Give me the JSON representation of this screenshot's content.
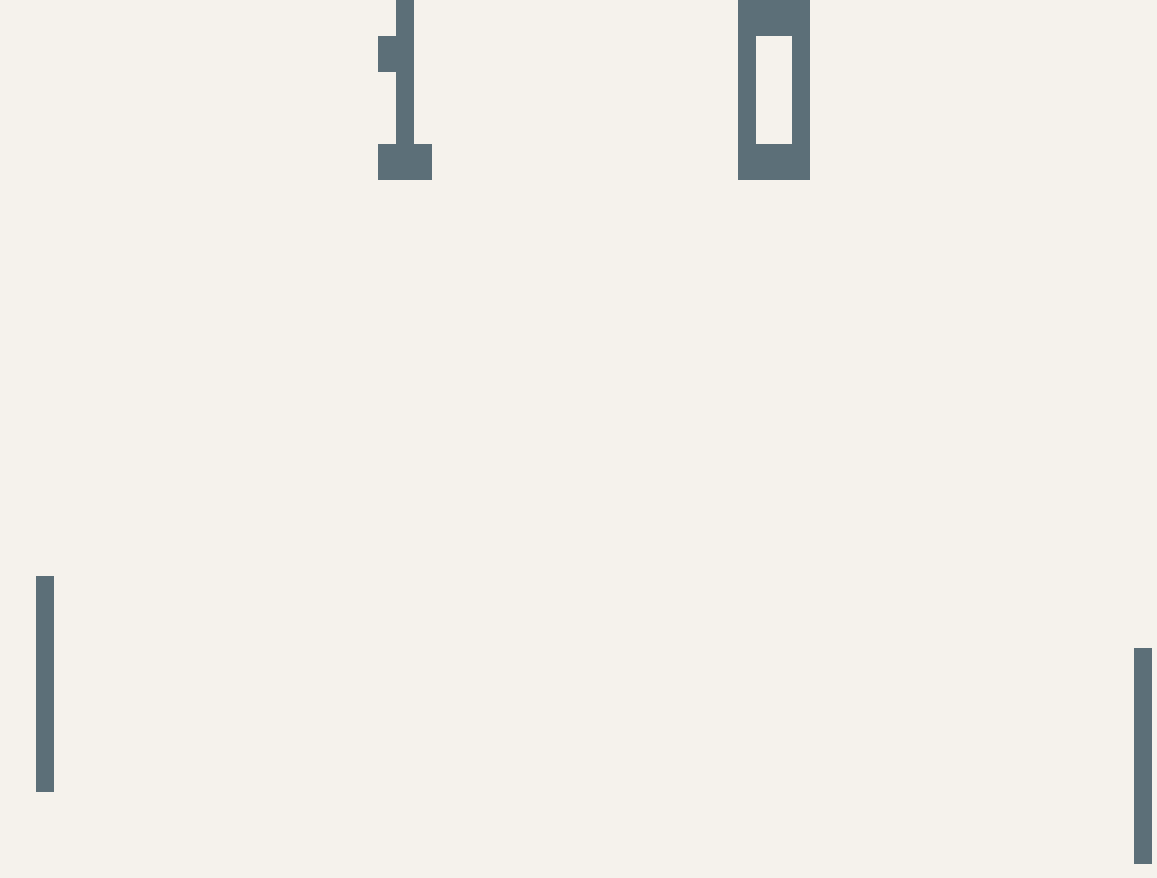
{
  "game": {
    "name": "pong",
    "colors": {
      "background": "#f5f2ec",
      "foreground": "#5c6f78"
    },
    "score": {
      "left": 1,
      "right": 0
    }
  }
}
